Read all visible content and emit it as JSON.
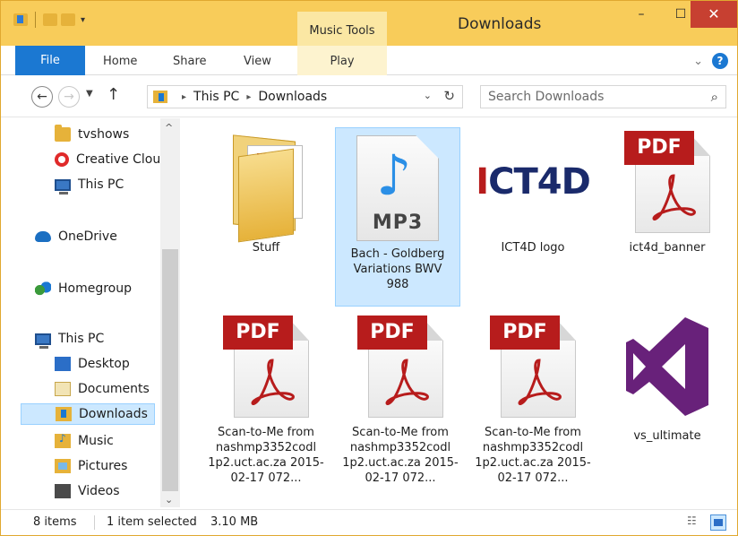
{
  "window": {
    "title": "Downloads",
    "context_tab": "Music Tools",
    "minimize": "–",
    "maximize": "☐",
    "close": "✕"
  },
  "ribbon": {
    "tabs": [
      {
        "label": "File"
      },
      {
        "label": "Home"
      },
      {
        "label": "Share"
      },
      {
        "label": "View"
      },
      {
        "label": "Play"
      }
    ],
    "expand": "⌄",
    "help": "?"
  },
  "navigation": {
    "back": "←",
    "forward": "→",
    "recent": "▼",
    "up": "↑",
    "breadcrumb": [
      "This PC",
      "Downloads"
    ],
    "address_dropdown": "⌄",
    "refresh": "↻",
    "search_placeholder": "Search Downloads",
    "search_icon": "⌕"
  },
  "nav_pane": {
    "items": [
      {
        "label": "tvshows",
        "icon": "folder-icon"
      },
      {
        "label": "Creative Cloud Files",
        "icon": "creative-cloud-icon"
      },
      {
        "label": "This PC",
        "icon": "computer-icon"
      },
      {
        "label": "OneDrive",
        "icon": "onedrive-icon"
      },
      {
        "label": "Homegroup",
        "icon": "homegroup-icon"
      },
      {
        "label": "This PC",
        "icon": "computer-icon"
      },
      {
        "label": "Desktop",
        "icon": "desktop-folder-icon"
      },
      {
        "label": "Documents",
        "icon": "documents-folder-icon"
      },
      {
        "label": "Downloads",
        "icon": "downloads-folder-icon"
      },
      {
        "label": "Music",
        "icon": "music-folder-icon"
      },
      {
        "label": "Pictures",
        "icon": "pictures-folder-icon"
      },
      {
        "label": "Videos",
        "icon": "videos-folder-icon"
      }
    ],
    "scroll_up": "^",
    "scroll_down": "⌄"
  },
  "files": [
    {
      "name": "Stuff",
      "type": "folder"
    },
    {
      "name": "Bach - Goldberg Variations BWV 988",
      "type": "mp3",
      "badge": "MP3"
    },
    {
      "name": "ICT4D logo",
      "type": "image",
      "logo_text": "ICT4D"
    },
    {
      "name": "ict4d_banner",
      "type": "pdf",
      "badge": "PDF"
    },
    {
      "name": "Scan-to-Me from nashmp3352codl 1p2.uct.ac.za 2015-02-17 072...",
      "type": "pdf",
      "badge": "PDF"
    },
    {
      "name": "Scan-to-Me from nashmp3352codl 1p2.uct.ac.za 2015-02-17 072...",
      "type": "pdf",
      "badge": "PDF"
    },
    {
      "name": "Scan-to-Me from nashmp3352codl 1p2.uct.ac.za 2015-02-17 072...",
      "type": "pdf",
      "badge": "PDF"
    },
    {
      "name": "vs_ultimate",
      "type": "exe"
    }
  ],
  "status": {
    "items": "8 items",
    "selected": "1 item selected",
    "size": "3.10 MB"
  },
  "colors": {
    "title_bar": "#f8cc5a",
    "file_tab": "#1b78d2",
    "selection": "#cce8ff",
    "close_button": "#c74031",
    "pdf_red": "#b71c1c",
    "vs_purple": "#68217a"
  }
}
